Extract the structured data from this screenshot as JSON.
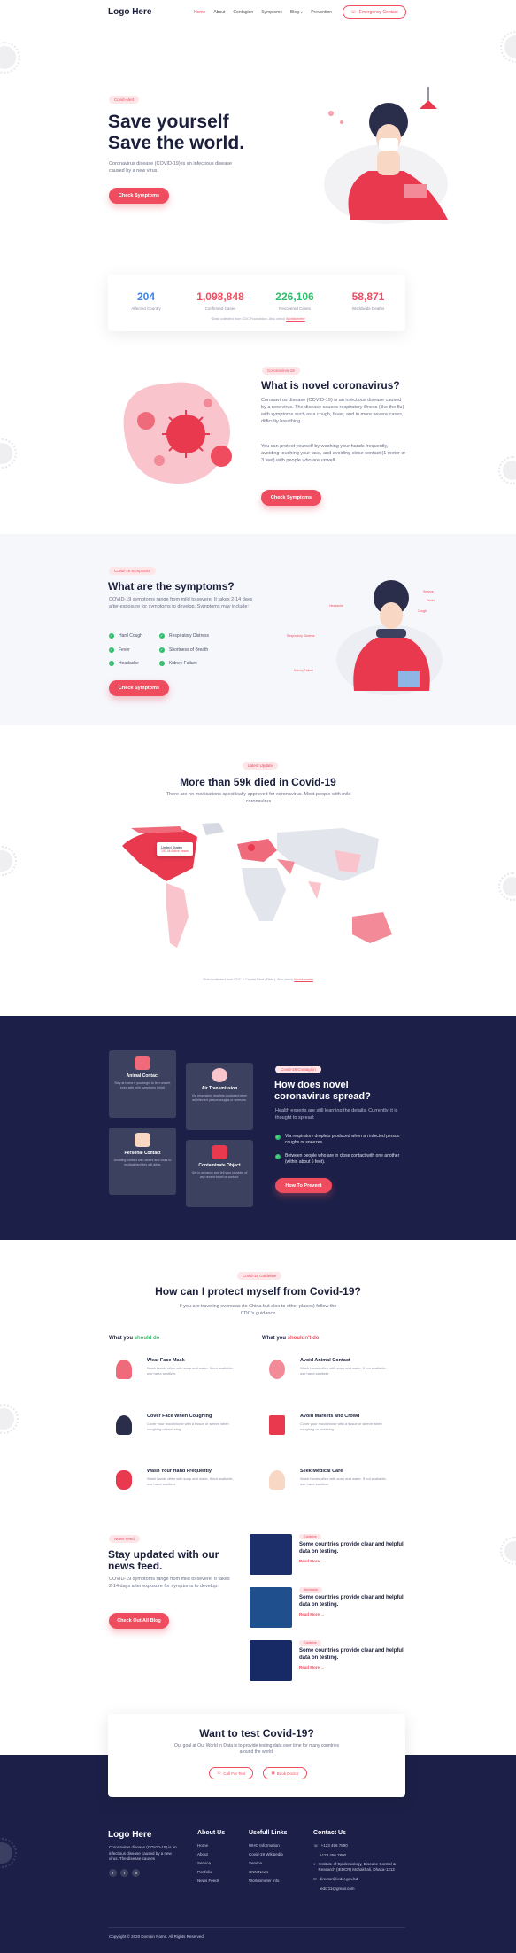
{
  "header": {
    "logo": "Logo Here",
    "nav": [
      "Home",
      "About",
      "Contagion",
      "Symptoms",
      "Blog",
      "Prevention"
    ],
    "nav_chevron": "∨",
    "emergency_button": "Emergency Contact"
  },
  "hero": {
    "tag": "Covid-Alert",
    "title_line1": "Save yourself",
    "title_line2": "Save the world.",
    "description": "Coronavirus disease (COVID-19) is an infectious disease caused by a new virus.",
    "button": "Check Symptoms"
  },
  "stats": {
    "items": [
      {
        "value": "204",
        "label": "Affected Country",
        "color": "#3e84e6"
      },
      {
        "value": "1,098,848",
        "label": "Confirmed Cases",
        "color": "#ef4c5f"
      },
      {
        "value": "226,106",
        "label": "Recovered Cases",
        "color": "#2ebf6b"
      },
      {
        "value": "58,871",
        "label": "Worldwide Deaths",
        "color": "#ef4c5f"
      }
    ],
    "source_text": "*Data collected from CDC Foundation. Also check ",
    "source_link": "Worldometer"
  },
  "novel": {
    "tag": "Coronavirus-19",
    "title": "What is novel coronavirus?",
    "para1": "Coronavirus disease (COVID-19) is an infectious disease caused by a new virus. The disease causes respiratory illness (like the flu) with symptoms such as a cough, fever, and in more severe cases, difficulty breathing.",
    "para2": "You can protect yourself by washing your hands frequently, avoiding touching your face, and avoiding close contact (1 meter or 3 feet) with people who are unwell.",
    "button": "Check Symptoms"
  },
  "symptoms": {
    "tag": "Covid-19 Symptoms",
    "title": "What are the symptoms?",
    "description": "COVID-19 symptoms range from mild to severe. It takes 2-14 days after exposure for symptoms to develop. Symptoms may include:",
    "list_left": [
      "Hard Cough",
      "Fever",
      "Headache"
    ],
    "list_right": [
      "Respiratory Distress",
      "Shortness of Breath",
      "Kidney Failure"
    ],
    "button": "Check Symptoms",
    "callouts": [
      "Headache",
      "Fever",
      "Cough",
      "Sneeze",
      "Respiratory Distress",
      "Kidney Failure"
    ]
  },
  "map": {
    "tag": "Latest Update",
    "title": "More than 59k died in Covid-19",
    "description": "There are no medications specifically approved for coronavirus. Most people with mild coronavirus",
    "tooltip_country": "United States",
    "tooltip_value": "193.4k Active cases",
    "source_text": "*Data collected from CDC & Crystal Pixel (Flickr). Also check ",
    "source_link": "Worldometer"
  },
  "spread": {
    "tag": "Covid-19 Contagion",
    "title_line1": "How does novel",
    "title_line2": "coronavirus spread?",
    "description": "Health experts are still learning the details. Currently, it is thought to spread:",
    "points": [
      "Via respiratory droplets produced when an infected person coughs or sneezes.",
      "Between people who are in close contact with one another (within about 6 feet)."
    ],
    "button": "How To Prevent",
    "cards": [
      {
        "title": "Animal Contact",
        "desc": "Stay at home if you begin to feel unwell, even with mild symptoms (mild)"
      },
      {
        "title": "Air Transmission",
        "desc": "Via respiratory droplets produced when an infected person coughs or sneezes."
      },
      {
        "title": "Personal Contact",
        "desc": "Avoiding contact with others and visits to medical facilities will allow."
      },
      {
        "title": "Contaminate Object",
        "desc": "Get in advance and tell your provider of any recent travel or contact."
      }
    ]
  },
  "protect": {
    "tag": "Covid-19 Guideline",
    "title": "How can I protect myself from Covid-19?",
    "description": "If you are traveling overseas (to China but also to other places) follow the CDC's guidance",
    "do_label": "What you ",
    "do_label_em": "should do",
    "dont_label": "What you ",
    "dont_label_em": "shouldn't do",
    "do_items": [
      {
        "title": "Wear Face Mask",
        "desc": "Wash hands often with soap and water. If not available, use hand sanitizer."
      },
      {
        "title": "Cover Face When Coughing",
        "desc": "Cover your mouth/nose with a tissue or sleeve when coughing or sneezing."
      },
      {
        "title": "Wash Your Hand Frequently",
        "desc": "Wash hands often with soap and water. If not available, use hand sanitizer."
      }
    ],
    "dont_items": [
      {
        "title": "Avoid Animal Contact",
        "desc": "Wash hands often with soap and water. If not available, use hand sanitizer."
      },
      {
        "title": "Avoid Markets and Crowd",
        "desc": "Cover your mouth/nose with a tissue or sleeve when coughing or sneezing."
      },
      {
        "title": "Seek Medical Care",
        "desc": "Wash hands often with soap and water. If not available, use hand sanitizer."
      }
    ]
  },
  "news": {
    "tag": "News Feed",
    "title_line1": "Stay updated with our",
    "title_line2": "news feed.",
    "description": "COVID-19 symptoms range from mild to severe. It takes 2-14 days after exposure for symptoms to develop.",
    "button": "Check Out All Blog",
    "items": [
      {
        "tag": "Guideline",
        "title": "Some countries provide clear and helpful data on testing.",
        "read": "Read More →"
      },
      {
        "tag": "Worldwide",
        "title": "Some countries provide clear and helpful data on testing.",
        "read": "Read More →"
      },
      {
        "tag": "Guideline",
        "title": "Some countries provide clear and helpful data on testing.",
        "read": "Read More →"
      }
    ]
  },
  "test": {
    "title": "Want to test Covid-19?",
    "description": "Our goal at Our World in Data is to provide testing data over time for many countries around the world.",
    "call_button": "Call For Test",
    "doctor_button": "Book Doctor"
  },
  "footer": {
    "logo": "Logo Here",
    "about_text": "Coronavirus disease (COVID-19) is an infectious disease caused by a new virus. The disease causes",
    "social": [
      "f",
      "t",
      "in"
    ],
    "col1_title": "About Us",
    "col1": [
      "Home",
      "About",
      "Service",
      "Portfolio",
      "News Feeds"
    ],
    "col2_title": "Usefull Links",
    "col2": [
      "WHO Information",
      "Covid-19 Wikipedia",
      "Service",
      "CNN News",
      "Worldometer Info"
    ],
    "col3_title": "Contact Us",
    "phones": [
      "+123 456 7890",
      "+123 456 7890"
    ],
    "address": "Institute of Epidemiology, Disease Control & Research (IEDCR) Mohakhali, Dhaka-1212",
    "emails": [
      "director@iedcr.gov.bd",
      "iedcr11@gmail.com"
    ],
    "copyright": "Copyright © 2020 Domain Name. All Rights Reserved."
  }
}
